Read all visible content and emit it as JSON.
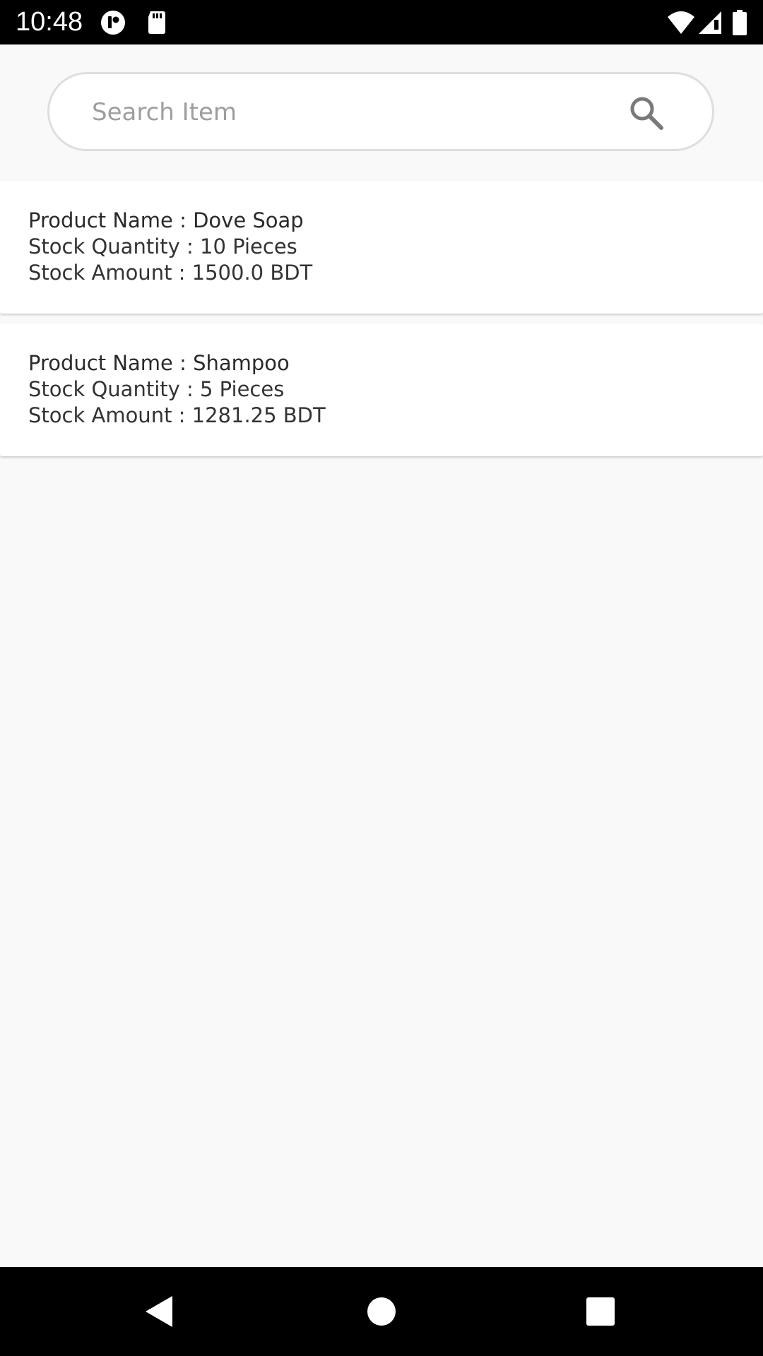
{
  "status_bar": {
    "time": "10:48"
  },
  "search": {
    "placeholder": "Search Item",
    "value": ""
  },
  "products": [
    {
      "name_line": "Product Name : Dove Soap",
      "quantity_line": "Stock Quantity : 10 Pieces",
      "amount_line": "Stock Amount : 1500.0 BDT"
    },
    {
      "name_line": "Product Name : Shampoo",
      "quantity_line": "Stock Quantity : 5 Pieces",
      "amount_line": "Stock Amount : 1281.25 BDT"
    }
  ],
  "icons": {
    "status_left": [
      "app-notification-icon",
      "sd-card-icon"
    ],
    "status_right": [
      "wifi-icon",
      "cell-signal-icon",
      "battery-icon"
    ],
    "search": "search-icon",
    "nav": [
      "back-icon",
      "home-icon",
      "recents-icon"
    ]
  },
  "colors": {
    "background": "#f9f9f9",
    "card": "#ffffff",
    "text": "#333333",
    "placeholder": "#9e9e9e",
    "system_bars": "#000000"
  }
}
